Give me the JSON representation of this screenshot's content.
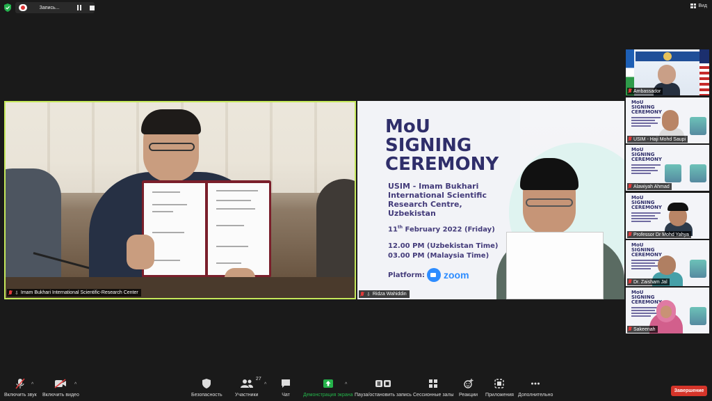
{
  "topbar": {
    "recording_label": "Запись...",
    "view_label": "Вид"
  },
  "main_tile": {
    "name": "Imam Bukhari International Scientific-Research Center"
  },
  "poster_tile": {
    "name": "Ridza Wahiddin",
    "title": "MoU\nSIGNING\nCEREMONY",
    "organization": "USIM - Imam Bukhari International Scientific Research Centre, Uzbekistan",
    "date_day": "11",
    "date_suffix": "th",
    "date_rest": " February 2022 (Friday)",
    "time_uz": "12.00 PM (Uzbekistan Time)",
    "time_my": "03.00 PM (Malaysia Time)",
    "platform_label": "Platform:",
    "platform_name": "zoom"
  },
  "gallery": [
    {
      "name": "Ambassador"
    },
    {
      "name": "USIM - Haji Mohd Saupi"
    },
    {
      "name": "Alawiyah Ahmad"
    },
    {
      "name": "Professor Dr Mohd Yahya"
    },
    {
      "name": "Dr. Zaisham Jal"
    },
    {
      "name": "Sakeenah"
    }
  ],
  "thumb_title": "MoU\nSIGNING\nCEREMONY",
  "toolbar": {
    "audio": "Включить звук",
    "video": "Включить видео",
    "security": "Безопасность",
    "participants": "Участники",
    "participants_count": "27",
    "chat": "Чат",
    "share": "Демонстрация экрана",
    "record": "Пауза/остановить запись",
    "breakout": "Сессионные залы",
    "reactions": "Реакции",
    "apps": "Приложения",
    "more": "Дополнительно",
    "end": "Завершение"
  },
  "colors": {
    "active_speaker_border": "#c6e95b",
    "share_green": "#25b34b",
    "end_red": "#d5352a",
    "poster_text": "#2f2e6a"
  }
}
